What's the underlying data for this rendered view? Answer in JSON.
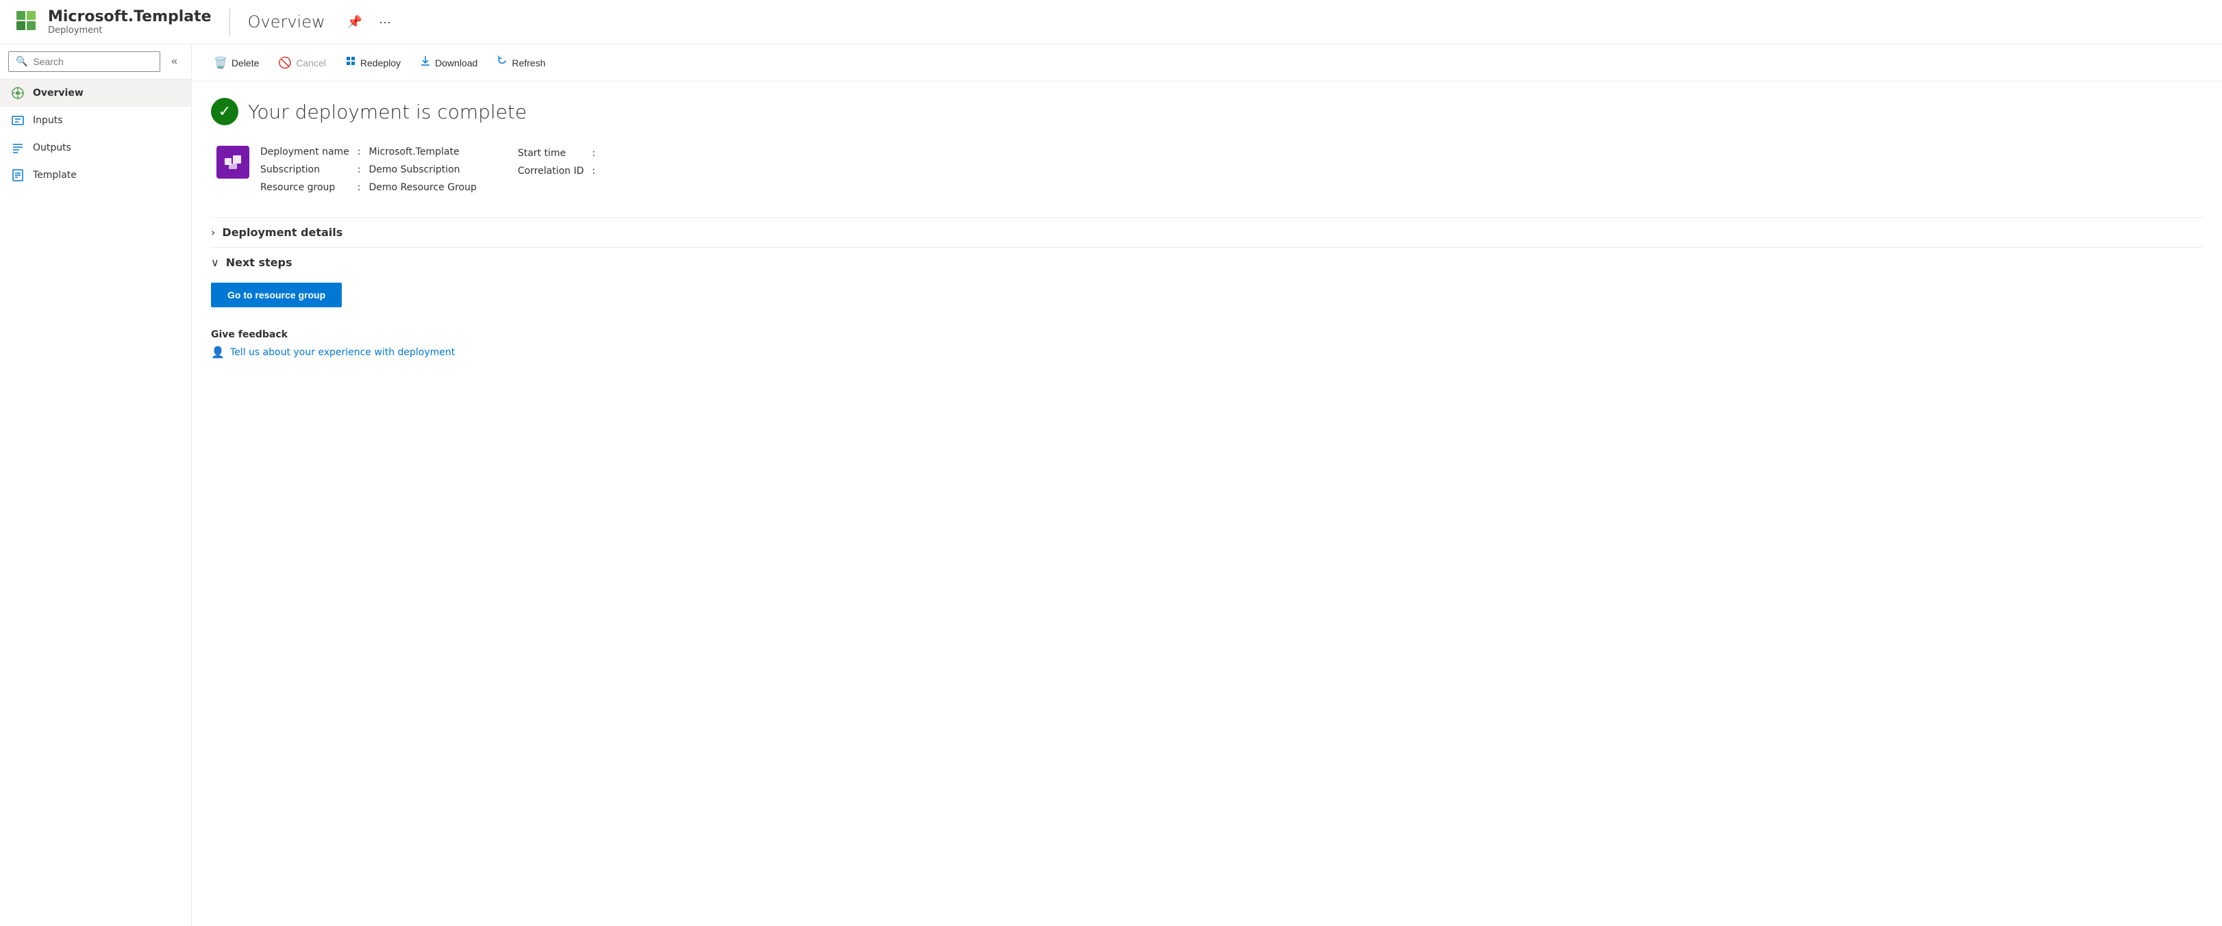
{
  "header": {
    "app_name": "Microsoft.Template",
    "app_subtitle": "Deployment",
    "page_title": "Overview",
    "pin_icon": "📌",
    "more_icon": "···"
  },
  "sidebar": {
    "search_placeholder": "Search",
    "collapse_icon": "«",
    "nav_items": [
      {
        "id": "overview",
        "label": "Overview",
        "icon": "overview",
        "active": true
      },
      {
        "id": "inputs",
        "label": "Inputs",
        "icon": "inputs",
        "active": false
      },
      {
        "id": "outputs",
        "label": "Outputs",
        "icon": "outputs",
        "active": false
      },
      {
        "id": "template",
        "label": "Template",
        "icon": "template",
        "active": false
      }
    ]
  },
  "toolbar": {
    "delete_label": "Delete",
    "cancel_label": "Cancel",
    "redeploy_label": "Redeploy",
    "download_label": "Download",
    "refresh_label": "Refresh"
  },
  "main": {
    "status_message": "Your deployment is complete",
    "deployment_name_label": "Deployment name",
    "deployment_name_value": "Microsoft.Template",
    "subscription_label": "Subscription",
    "subscription_value": "Demo Subscription",
    "resource_group_label": "Resource group",
    "resource_group_value": "Demo Resource Group",
    "start_time_label": "Start time",
    "start_time_value": "",
    "correlation_id_label": "Correlation ID",
    "correlation_id_value": "",
    "deployment_details_label": "Deployment details",
    "next_steps_label": "Next steps",
    "go_to_resource_group_label": "Go to resource group",
    "feedback_title": "Give feedback",
    "feedback_link": "Tell us about your experience with deployment"
  },
  "colors": {
    "accent_blue": "#0078d4",
    "success_green": "#107c10",
    "template_purple": "#7719aa"
  }
}
